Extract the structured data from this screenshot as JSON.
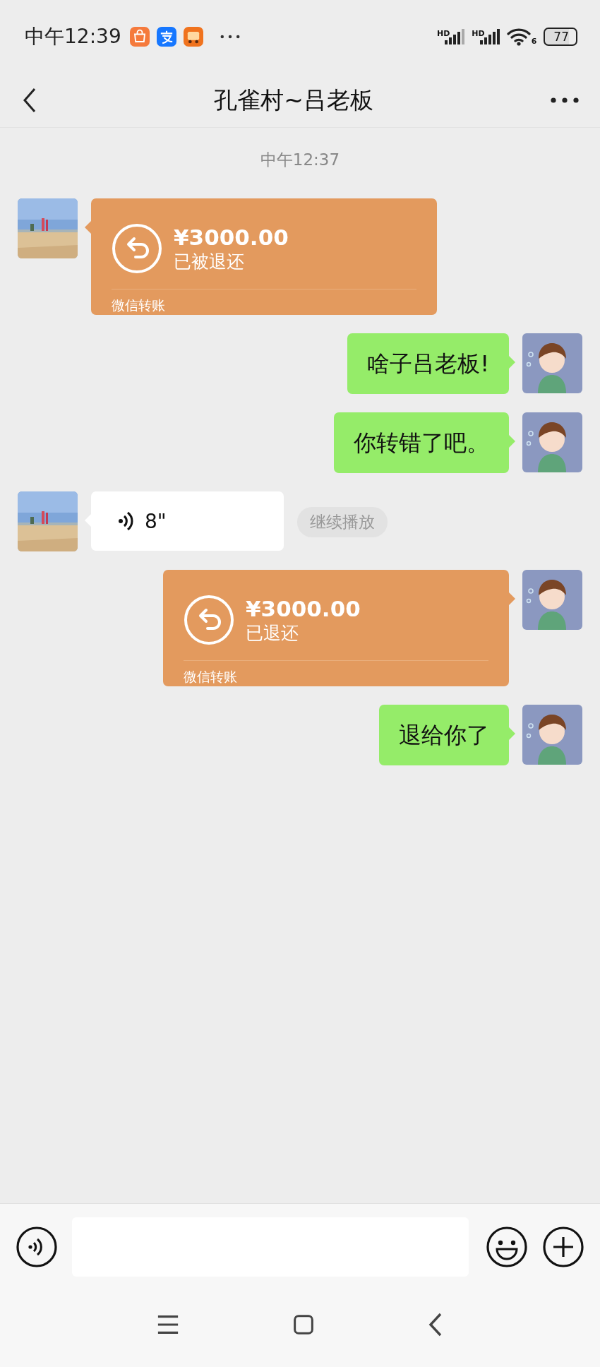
{
  "status_bar": {
    "time": "中午12:39",
    "signals": [
      {
        "label": "HD"
      },
      {
        "label": "HD"
      }
    ],
    "wifi_label": "6",
    "battery": "77"
  },
  "nav": {
    "title": "孔雀村~吕老板"
  },
  "timestamp": "中午12:37",
  "messages": [
    {
      "kind": "transfer",
      "from_me": false,
      "amount": "¥3000.00",
      "status": "已被退还",
      "footer": "微信转账"
    },
    {
      "kind": "text",
      "from_me": true,
      "text": "啥子吕老板!"
    },
    {
      "kind": "text",
      "from_me": true,
      "text": "你转错了吧。"
    },
    {
      "kind": "voice",
      "from_me": false,
      "duration": "8\"",
      "action": "继续播放"
    },
    {
      "kind": "transfer",
      "from_me": true,
      "amount": "¥3000.00",
      "status": "已退还",
      "footer": "微信转账"
    },
    {
      "kind": "text",
      "from_me": true,
      "text": "退给你了"
    }
  ]
}
